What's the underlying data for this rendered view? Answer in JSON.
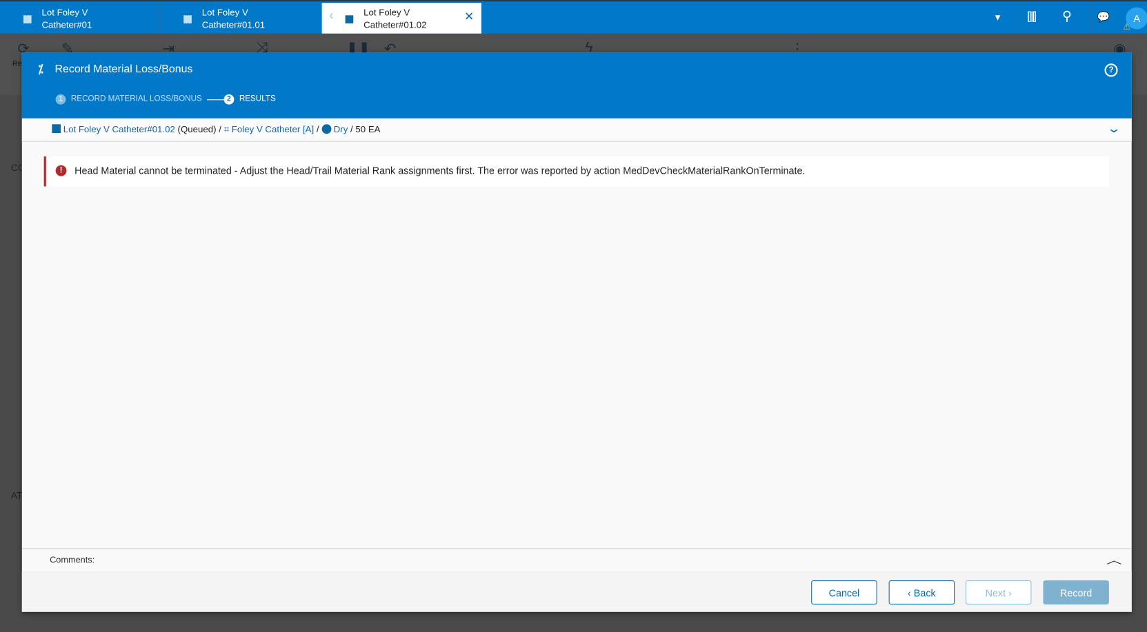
{
  "tabs": [
    {
      "line1": "Lot Foley V",
      "line2": "Catheter#01"
    },
    {
      "line1": "Lot Foley V",
      "line2": "Catheter#01.01"
    },
    {
      "line1": "Lot Foley V",
      "line2": "Catheter#01.02"
    }
  ],
  "user": {
    "avatar_letter": "A"
  },
  "background": {
    "toolbar_partial_label": "Re",
    "left_label_1": "CO",
    "left_label_2": "AT"
  },
  "dialog": {
    "title": "Record Material Loss/Bonus",
    "steps": [
      {
        "number": "1",
        "label": "RECORD MATERIAL LOSS/BONUS"
      },
      {
        "number": "2",
        "label": "RESULTS"
      }
    ],
    "breadcrumb": {
      "lot": "Lot Foley V Catheter#01.02",
      "state": "(Queued)",
      "product": "Foley V Catheter [A]",
      "step": "Dry",
      "quantity": "50 EA"
    },
    "error_message": "Head Material cannot be terminated - Adjust the Head/Trail Material Rank assignments first. The error was reported by action MedDevCheckMaterialRankOnTerminate.",
    "comments_label": "Comments:",
    "buttons": {
      "cancel": "Cancel",
      "back": "Back",
      "next": "Next",
      "record": "Record"
    }
  },
  "colors": {
    "brand": "#0179c8",
    "error": "#b52a2a"
  }
}
